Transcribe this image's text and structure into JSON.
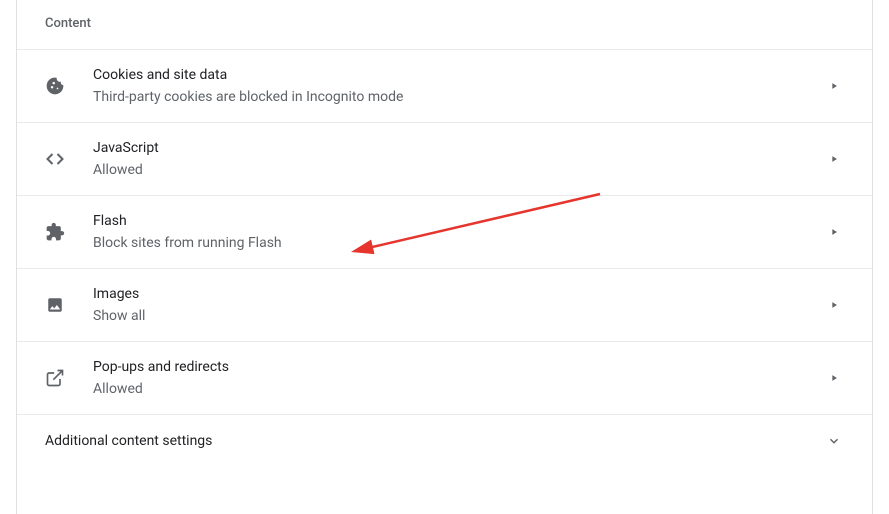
{
  "section": {
    "header": "Content"
  },
  "rows": {
    "cookies": {
      "title": "Cookies and site data",
      "subtitle": "Third-party cookies are blocked in Incognito mode"
    },
    "javascript": {
      "title": "JavaScript",
      "subtitle": "Allowed"
    },
    "flash": {
      "title": "Flash",
      "subtitle": "Block sites from running Flash"
    },
    "images": {
      "title": "Images",
      "subtitle": "Show all"
    },
    "popups": {
      "title": "Pop-ups and redirects",
      "subtitle": "Allowed"
    }
  },
  "expander": {
    "label": "Additional content settings"
  }
}
